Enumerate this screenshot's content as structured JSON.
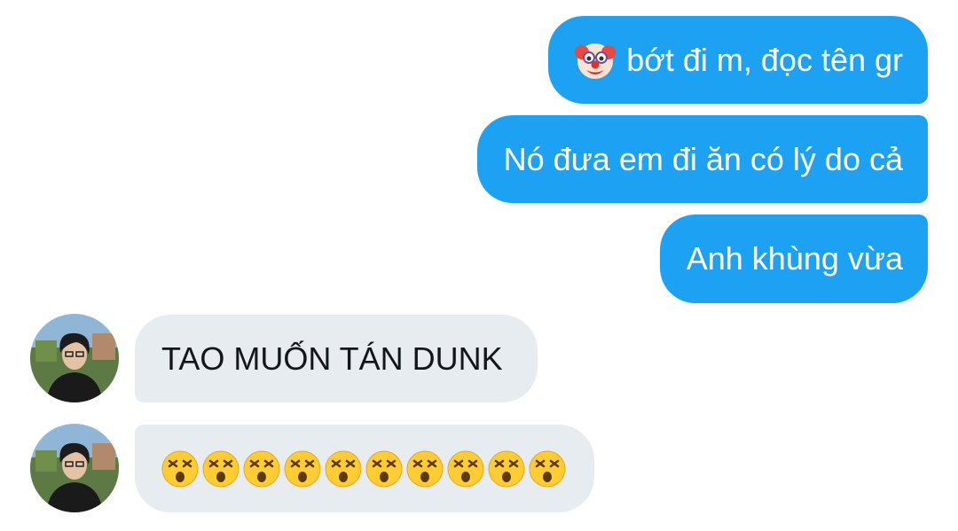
{
  "messages": {
    "sent": [
      {
        "text": "bớt đi m, đọc tên gr",
        "emoji": "clown-face"
      },
      {
        "text": "Nó đưa em đi ăn có lý do cả"
      },
      {
        "text": "Anh khùng vừa"
      }
    ],
    "received": [
      {
        "text": "TAO MUỐN TÁN DUNK"
      },
      {
        "emoji": "dizzy-face",
        "emoji_count": 10
      }
    ]
  },
  "colors": {
    "sent_bubble": "#1da1f2",
    "sent_text": "#ffffff",
    "received_bubble": "#e6ecf0",
    "received_text": "#14171a",
    "background": "#ffffff"
  }
}
